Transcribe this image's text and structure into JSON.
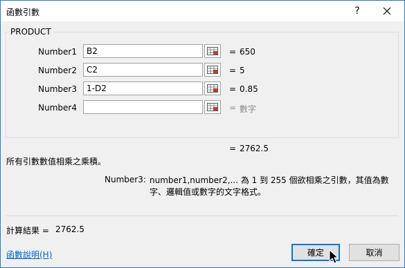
{
  "window": {
    "title": "函數引數",
    "help_label": "?"
  },
  "function": {
    "name": "PRODUCT",
    "args": [
      {
        "label": "Number1",
        "value": "B2",
        "result": "650",
        "placeholder": ""
      },
      {
        "label": "Number2",
        "value": "C2",
        "result": "5",
        "placeholder": ""
      },
      {
        "label": "Number3",
        "value": "1-D2",
        "result": "0.85",
        "placeholder": ""
      },
      {
        "label": "Number4",
        "value": "",
        "result": "數字",
        "placeholder": ""
      }
    ],
    "equals_sign": "=",
    "result": "2762.5",
    "description": "所有引數數值相乘之乘積。",
    "arg_help": {
      "name": "Number3:",
      "text": "number1,number2,... 為 1 到 255 個欲相乘之引數，其值為數字、邏輯值或數字的文字格式。"
    }
  },
  "footer": {
    "calc_label": "計算結果 =",
    "calc_value": "2762.5",
    "help_link": "函數說明(H)",
    "ok_label": "確定",
    "cancel_label": "取消"
  },
  "colors": {
    "accent": "#0078d7",
    "link": "#0066cc",
    "hint": "#8a8a8a"
  }
}
